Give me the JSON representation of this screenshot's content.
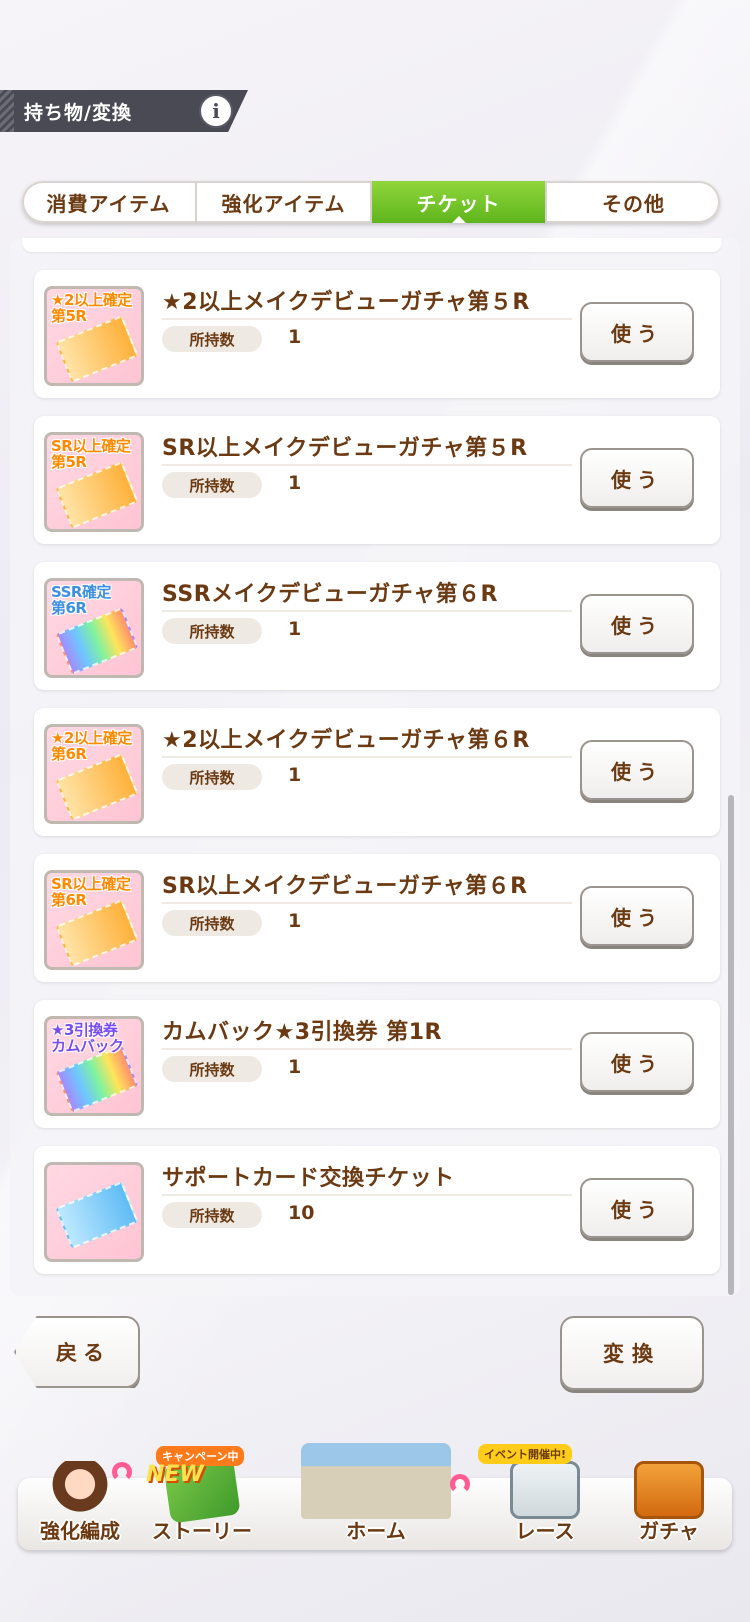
{
  "header": {
    "title": "持ち物/変換",
    "info_icon_label": "i"
  },
  "tabs": [
    {
      "label": "消費アイテム",
      "active": false
    },
    {
      "label": "強化アイテム",
      "active": false
    },
    {
      "label": "チケット",
      "active": true
    },
    {
      "label": "その他",
      "active": false
    }
  ],
  "owned_label": "所持数",
  "use_label": "使う",
  "items": [
    {
      "name": "★2以上メイクデビューガチャ第５R",
      "count": "1",
      "icon": "star2-5r-ticket-icon",
      "badge": "★2以上確定\n第5R"
    },
    {
      "name": "SR以上メイクデビューガチャ第５R",
      "count": "1",
      "icon": "sr-5r-ticket-icon",
      "badge": "SR以上確定\n第5R"
    },
    {
      "name": "SSRメイクデビューガチャ第６R",
      "count": "1",
      "icon": "ssr-6r-ticket-icon",
      "badge": "SSR確定\n第6R"
    },
    {
      "name": "★2以上メイクデビューガチャ第６R",
      "count": "1",
      "icon": "star2-6r-ticket-icon",
      "badge": "★2以上確定\n第6R"
    },
    {
      "name": "SR以上メイクデビューガチャ第６R",
      "count": "1",
      "icon": "sr-6r-ticket-icon",
      "badge": "SR以上確定\n第6R"
    },
    {
      "name": "カムバック★3引換券 第1R",
      "count": "1",
      "icon": "comeback-star3-ticket-icon",
      "badge": "★3引換券\nカムバック"
    },
    {
      "name": "サポートカード交換チケット",
      "count": "10",
      "icon": "support-card-ticket-icon",
      "badge": ""
    }
  ],
  "buttons": {
    "back": "戻る",
    "convert": "変換"
  },
  "bottom_nav": {
    "items": [
      {
        "label": "強化編成",
        "icon": "training-formation-icon"
      },
      {
        "label": "ストーリー",
        "icon": "story-book-icon",
        "badge": "キャンペーン中",
        "new": "NEW"
      },
      {
        "label": "ホーム",
        "icon": "home-building-icon"
      },
      {
        "label": "レース",
        "icon": "race-gate-icon",
        "badge": "イベント開催中!"
      },
      {
        "label": "ガチャ",
        "icon": "gacha-gate-icon"
      }
    ]
  },
  "colors": {
    "accent_green": "#6fc52a",
    "text_brown": "#6b3a12",
    "header_dark": "#4a4a55"
  }
}
